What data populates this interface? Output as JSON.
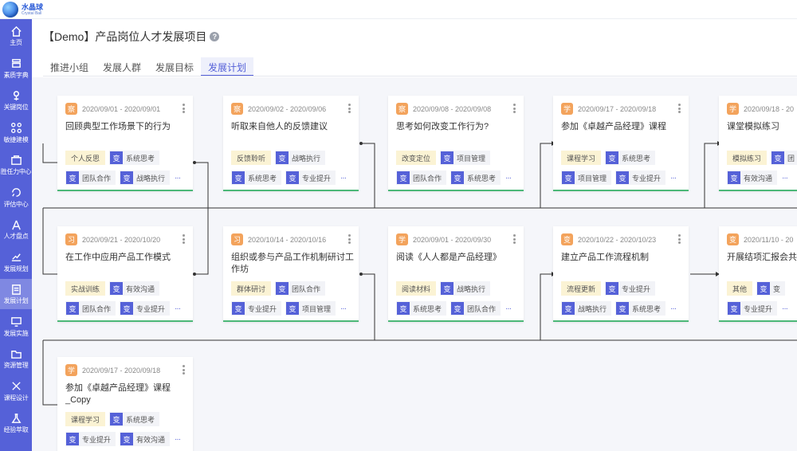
{
  "app": {
    "brand_cn": "水晶球",
    "brand_en": "Crystal Ball"
  },
  "sidebar": {
    "items": [
      {
        "label": "主页",
        "icon": "home-icon"
      },
      {
        "label": "素质字典",
        "icon": "dictionary-icon"
      },
      {
        "label": "关键岗位",
        "icon": "key-position-icon"
      },
      {
        "label": "敏捷建模",
        "icon": "modeling-icon"
      },
      {
        "label": "胜任力中心",
        "icon": "competency-icon"
      },
      {
        "label": "评估中心",
        "icon": "assessment-icon"
      },
      {
        "label": "人才盘点",
        "icon": "talent-review-icon"
      },
      {
        "label": "发展规划",
        "icon": "development-plan-icon"
      },
      {
        "label": "发展计划",
        "icon": "plan-icon",
        "active": true
      },
      {
        "label": "发展实施",
        "icon": "implementation-icon"
      },
      {
        "label": "资源管理",
        "icon": "resource-icon"
      },
      {
        "label": "课程设计",
        "icon": "course-design-icon"
      },
      {
        "label": "经验萃取",
        "icon": "experience-icon"
      }
    ]
  },
  "page": {
    "title": "【Demo】产品岗位人才发展项目",
    "help_icon": "?"
  },
  "tabs": [
    {
      "label": "推进小组"
    },
    {
      "label": "发展人群"
    },
    {
      "label": "发展目标"
    },
    {
      "label": "发展计划",
      "active": true
    }
  ],
  "chip_icon_char": "变",
  "more_char": "···",
  "cards": [
    {
      "type": "察",
      "date": "2020/09/01 - 2020/09/01",
      "title": "回顾典型工作场景下的行为",
      "tag": "个人反思",
      "chips1": [
        "系统思考"
      ],
      "chips2": [
        "团队合作",
        "战略执行"
      ]
    },
    {
      "type": "察",
      "date": "2020/09/02 - 2020/09/06",
      "title": "听取来自他人的反馈建议",
      "tag": "反馈聆听",
      "chips1": [
        "战略执行"
      ],
      "chips2": [
        "系统思考",
        "专业提升"
      ]
    },
    {
      "type": "察",
      "date": "2020/09/08 - 2020/09/08",
      "title": "思考如何改变工作行为?",
      "tag": "改变定位",
      "chips1": [
        "项目管理"
      ],
      "chips2": [
        "团队合作",
        "系统思考"
      ]
    },
    {
      "type": "学",
      "date": "2020/09/17 - 2020/09/18",
      "title": "参加《卓越产品经理》课程",
      "tag": "课程学习",
      "chips1": [
        "系统思考"
      ],
      "chips2": [
        "项目管理",
        "专业提升"
      ]
    },
    {
      "type": "学",
      "date": "2020/09/18 - 20",
      "title": "课堂模拟练习",
      "tag": "模拟练习",
      "chips1": [
        "团"
      ],
      "chips2": [
        "有效沟通"
      ]
    },
    {
      "type": "习",
      "date": "2020/09/21 - 2020/10/20",
      "title": "在工作中应用产品工作模式",
      "tag": "实战训练",
      "chips1": [
        "有效沟通"
      ],
      "chips2": [
        "团队合作",
        "专业提升"
      ]
    },
    {
      "type": "习",
      "date": "2020/10/14 - 2020/10/16",
      "title": "组织或参与产品工作机制研讨工作坊",
      "tag": "群体研讨",
      "chips1": [
        "团队合作"
      ],
      "chips2": [
        "专业提升",
        "项目管理"
      ]
    },
    {
      "type": "学",
      "date": "2020/09/01 - 2020/09/30",
      "title": "阅读《人人都是产品经理》",
      "tag": "阅读材料",
      "chips1": [
        "战略执行"
      ],
      "chips2": [
        "系统思考",
        "团队合作"
      ]
    },
    {
      "type": "变",
      "date": "2020/10/22 - 2020/10/23",
      "title": "建立产品工作流程机制",
      "tag": "流程更新",
      "chips1": [
        "专业提升"
      ],
      "chips2": [
        "战略执行",
        "系统思考"
      ]
    },
    {
      "type": "变",
      "date": "2020/11/10 - 20",
      "title": "开展结项汇报会共识果",
      "tag": "其他",
      "chips1": [
        "变"
      ],
      "chips2": [
        "专业提升"
      ]
    },
    {
      "type": "学",
      "date": "2020/09/17 - 2020/09/18",
      "title": "参加《卓越产品经理》课程_Copy",
      "tag": "课程学习",
      "chips1": [
        "系统思考"
      ],
      "chips2": [
        "专业提升",
        "有效沟通"
      ]
    }
  ],
  "colors": {
    "sidebar": "#5561d8",
    "accent": "#5561d8",
    "badge": "#f3a35c",
    "tag_bg": "#fbf3d4",
    "card_border": "#4cb878"
  }
}
